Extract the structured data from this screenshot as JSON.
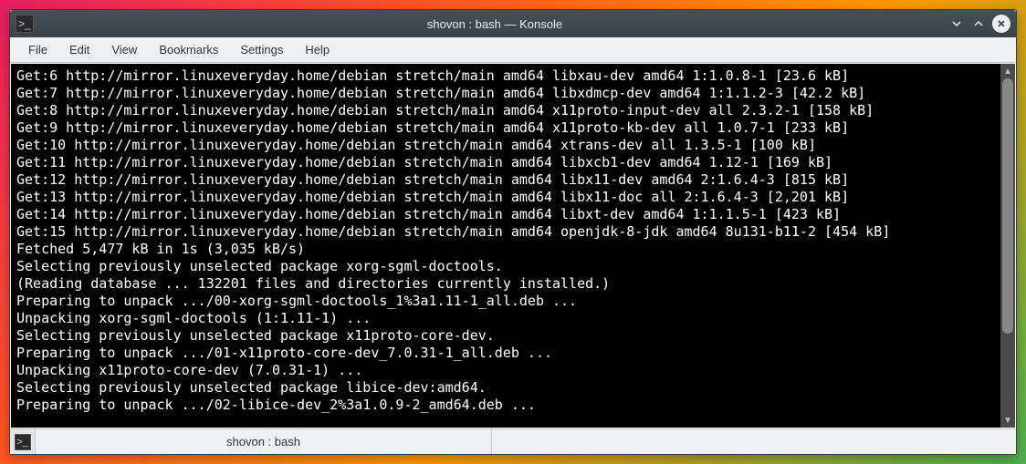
{
  "window": {
    "title": "shovon : bash — Konsole"
  },
  "menubar": {
    "items": [
      "File",
      "Edit",
      "View",
      "Bookmarks",
      "Settings",
      "Help"
    ]
  },
  "terminal": {
    "lines": [
      "Get:6 http://mirror.linuxeveryday.home/debian stretch/main amd64 libxau-dev amd64 1:1.0.8-1 [23.6 kB]",
      "Get:7 http://mirror.linuxeveryday.home/debian stretch/main amd64 libxdmcp-dev amd64 1:1.1.2-3 [42.2 kB]",
      "Get:8 http://mirror.linuxeveryday.home/debian stretch/main amd64 x11proto-input-dev all 2.3.2-1 [158 kB]",
      "Get:9 http://mirror.linuxeveryday.home/debian stretch/main amd64 x11proto-kb-dev all 1.0.7-1 [233 kB]",
      "Get:10 http://mirror.linuxeveryday.home/debian stretch/main amd64 xtrans-dev all 1.3.5-1 [100 kB]",
      "Get:11 http://mirror.linuxeveryday.home/debian stretch/main amd64 libxcb1-dev amd64 1.12-1 [169 kB]",
      "Get:12 http://mirror.linuxeveryday.home/debian stretch/main amd64 libx11-dev amd64 2:1.6.4-3 [815 kB]",
      "Get:13 http://mirror.linuxeveryday.home/debian stretch/main amd64 libx11-doc all 2:1.6.4-3 [2,201 kB]",
      "Get:14 http://mirror.linuxeveryday.home/debian stretch/main amd64 libxt-dev amd64 1:1.1.5-1 [423 kB]",
      "Get:15 http://mirror.linuxeveryday.home/debian stretch/main amd64 openjdk-8-jdk amd64 8u131-b11-2 [454 kB]",
      "Fetched 5,477 kB in 1s (3,035 kB/s)",
      "Selecting previously unselected package xorg-sgml-doctools.",
      "(Reading database ... 132201 files and directories currently installed.)",
      "Preparing to unpack .../00-xorg-sgml-doctools_1%3a1.11-1_all.deb ...",
      "Unpacking xorg-sgml-doctools (1:1.11-1) ...",
      "Selecting previously unselected package x11proto-core-dev.",
      "Preparing to unpack .../01-x11proto-core-dev_7.0.31-1_all.deb ...",
      "Unpacking x11proto-core-dev (7.0.31-1) ...",
      "Selecting previously unselected package libice-dev:amd64.",
      "Preparing to unpack .../02-libice-dev_2%3a1.0.9-2_amd64.deb ..."
    ]
  },
  "tabs": {
    "items": [
      {
        "label": "shovon : bash"
      }
    ]
  }
}
